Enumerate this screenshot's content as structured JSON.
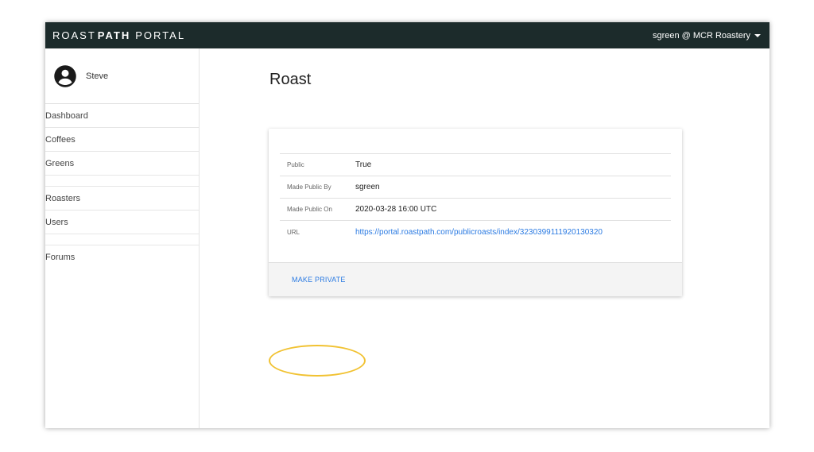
{
  "topbar": {
    "brand_part1": "ROAST",
    "brand_part2": "PATH",
    "brand_part3": "PORTAL",
    "user_label": "sgreen @ MCR Roastery"
  },
  "sidebar": {
    "profile_name": "Steve",
    "items": [
      {
        "label": "Dashboard"
      },
      {
        "label": "Coffees"
      },
      {
        "label": "Greens"
      },
      {
        "label": "Roasters"
      },
      {
        "label": "Users"
      },
      {
        "label": "Forums"
      }
    ]
  },
  "main": {
    "title": "Roast",
    "rows": [
      {
        "label": "Public",
        "value": "True"
      },
      {
        "label": "Made Public By",
        "value": "sgreen"
      },
      {
        "label": "Made Public On",
        "value": "2020-03-28 16:00 UTC"
      },
      {
        "label": "URL",
        "value": "https://portal.roastpath.com/publicroasts/index/3230399111920130320"
      }
    ],
    "make_private_label": "MAKE PRIVATE"
  },
  "colors": {
    "topbar_bg": "#1c2b2b",
    "link": "#2a7ae2",
    "highlight": "#f1c232"
  },
  "icons": {
    "avatar": "account-circle-icon",
    "user_menu": "caret-down-icon"
  }
}
